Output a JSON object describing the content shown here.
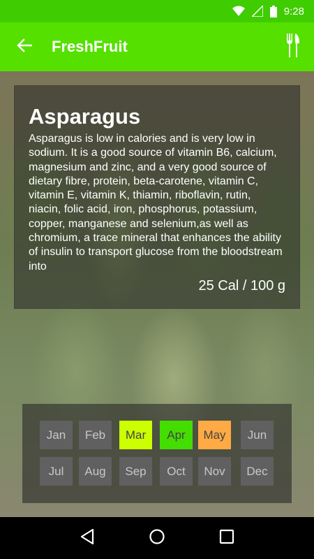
{
  "status": {
    "time": "9:28"
  },
  "app": {
    "title": "FreshFruit"
  },
  "fruit": {
    "name": "Asparagus",
    "description": "Asparagus is low in calories and is very low in sodium. It is a good source of vitamin B6, calcium, magnesium and zinc, and a very good source of dietary fibre, protein, beta-carotene, vitamin C, vitamin E, vitamin K, thiamin, riboflavin, rutin, niacin, folic acid, iron, phosphorus, potassium, copper, manganese and selenium,as well as chromium, a trace mineral that enhances the ability of insulin to transport glucose from the bloodstream into",
    "calories": "25 Cal / 100 g"
  },
  "months": [
    {
      "label": "Jan",
      "in_season": false
    },
    {
      "label": "Feb",
      "in_season": false
    },
    {
      "label": "Mar",
      "in_season": true,
      "color": "#ccff00"
    },
    {
      "label": "Apr",
      "in_season": true,
      "color": "#44dd00"
    },
    {
      "label": "May",
      "in_season": true,
      "color": "#ffaa44"
    },
    {
      "label": "Jun",
      "in_season": false
    },
    {
      "label": "Jul",
      "in_season": false
    },
    {
      "label": "Aug",
      "in_season": false
    },
    {
      "label": "Sep",
      "in_season": false
    },
    {
      "label": "Oct",
      "in_season": false
    },
    {
      "label": "Nov",
      "in_season": false
    },
    {
      "label": "Dec",
      "in_season": false
    }
  ],
  "colors": {
    "status_bar": "#3fcc00",
    "app_bar": "#55e000",
    "month_default": "#606060"
  },
  "icons": {
    "back": "arrow-left-icon",
    "menu": "fork-knife-icon",
    "wifi": "wifi-icon",
    "signal": "signal-icon",
    "battery": "battery-icon",
    "nav_back": "triangle-back-icon",
    "nav_home": "circle-home-icon",
    "nav_recents": "square-recents-icon"
  }
}
